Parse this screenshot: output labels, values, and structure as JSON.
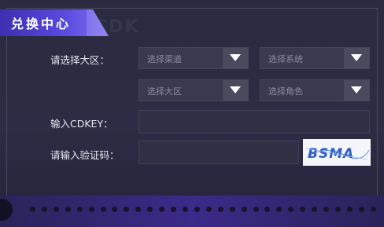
{
  "header": {
    "title": "兑换中心",
    "watermark": "CDK"
  },
  "form": {
    "region_label": "请选择大区：",
    "selects": [
      {
        "placeholder": "选择渠道"
      },
      {
        "placeholder": "选择系统"
      },
      {
        "placeholder": "选择大区"
      },
      {
        "placeholder": "选择角色"
      }
    ],
    "cdkey_label": "输入CDKEY：",
    "cdkey_value": "",
    "captcha_label": "请输入验证码：",
    "captcha_value": "",
    "captcha_image_text": "BSMA"
  },
  "colors": {
    "accent": "#5a4be0",
    "panel": "#2d2c44",
    "field": "#3a3a4f"
  }
}
